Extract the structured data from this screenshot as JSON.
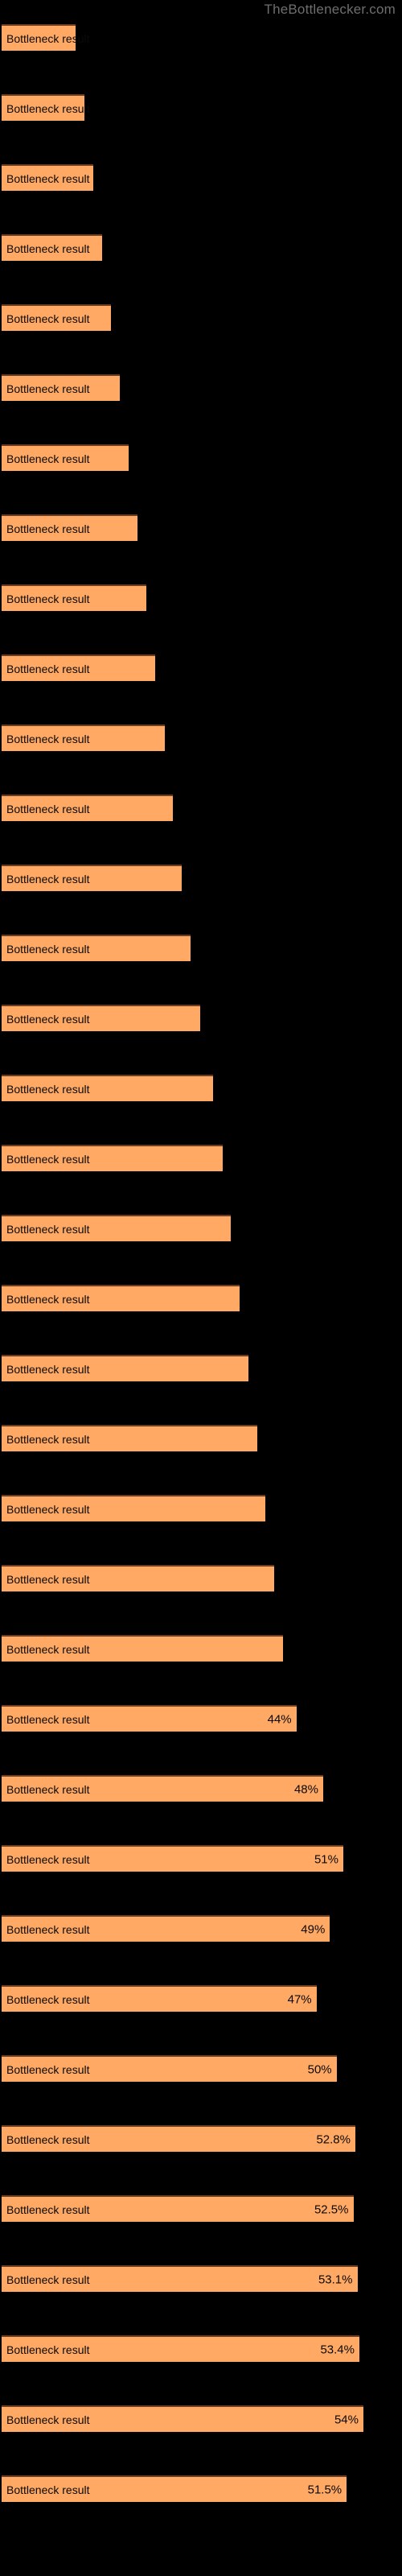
{
  "watermark": "TheBottlenecker.com",
  "chart_data": {
    "type": "bar",
    "orientation": "horizontal",
    "title": "",
    "xlabel": "",
    "ylabel": "",
    "xlim": [
      0,
      60
    ],
    "grid": false,
    "legend": null,
    "bar_color": "#ffa964",
    "bar_edge_color": "#6b3d1e",
    "background": "#000000",
    "watermark_color": "#6e6e6e",
    "label_text": "Bottleneck result",
    "categories": [
      "Bottleneck result",
      "Bottleneck result",
      "Bottleneck result",
      "Bottleneck result",
      "Bottleneck result",
      "Bottleneck result",
      "Bottleneck result",
      "Bottleneck result",
      "Bottleneck result",
      "Bottleneck result",
      "Bottleneck result",
      "Bottleneck result",
      "Bottleneck result",
      "Bottleneck result",
      "Bottleneck result",
      "Bottleneck result",
      "Bottleneck result",
      "Bottleneck result",
      "Bottleneck result",
      "Bottleneck result",
      "Bottleneck result",
      "Bottleneck result",
      "Bottleneck result",
      "Bottleneck result",
      "Bottleneck result",
      "Bottleneck result",
      "Bottleneck result",
      "Bottleneck result",
      "Bottleneck result",
      "Bottleneck result",
      "Bottleneck result",
      "Bottleneck result",
      "Bottleneck result",
      "Bottleneck result",
      "Bottleneck result",
      "Bottleneck result"
    ],
    "values": [
      11.0,
      12.4,
      13.7,
      15.0,
      16.3,
      17.6,
      19.0,
      20.3,
      21.6,
      22.9,
      24.3,
      25.6,
      26.9,
      28.2,
      29.6,
      31.5,
      33.0,
      34.2,
      35.5,
      36.8,
      38.1,
      39.4,
      40.7,
      42.0,
      44.0,
      48.0,
      51.0,
      49.0,
      47.0,
      50.0,
      52.8,
      52.5,
      53.1,
      53.4,
      54.0,
      51.5
    ],
    "value_labels": [
      "",
      "",
      "",
      "",
      "",
      "",
      "",
      "",
      "",
      "",
      "",
      "",
      "",
      "",
      "",
      "",
      "",
      "",
      "",
      "",
      "",
      "",
      "",
      "",
      "44%",
      "48%",
      "51%",
      "49%",
      "47%",
      "50%",
      "52.8%",
      "52.5%",
      "53.1%",
      "53.4%",
      "54%",
      "51.5%"
    ]
  }
}
